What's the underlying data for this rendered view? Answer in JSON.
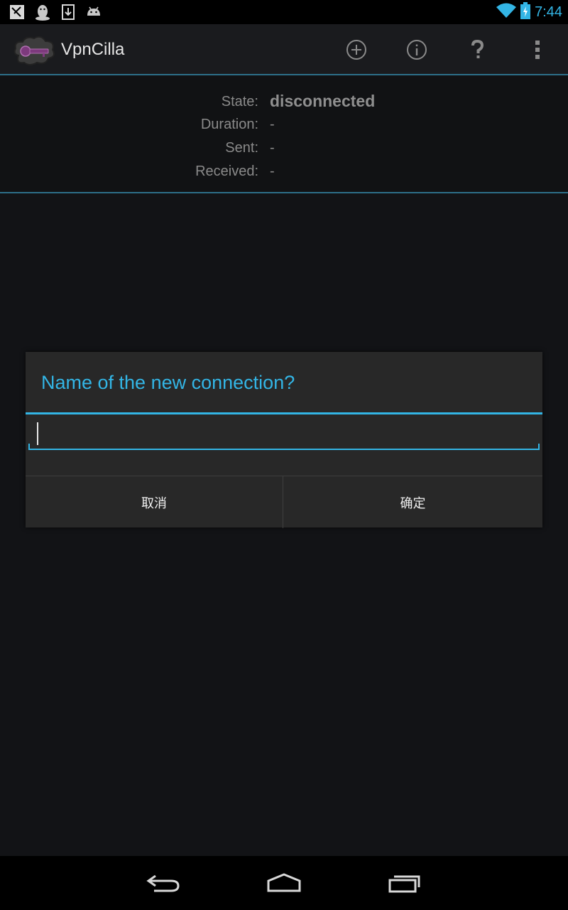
{
  "status_bar": {
    "time": "7:44",
    "left_icons": [
      "screenshot-icon",
      "qq-penguin-icon",
      "download-icon",
      "android-icon"
    ],
    "right_icons": [
      "wifi-icon",
      "battery-charging-icon"
    ]
  },
  "action_bar": {
    "title": "VpnCilla",
    "actions": [
      "add-icon",
      "info-icon",
      "help-icon",
      "overflow-menu-icon"
    ]
  },
  "status_panel": {
    "rows": [
      {
        "label": "State:",
        "value": "disconnected"
      },
      {
        "label": "Duration:",
        "value": "-"
      },
      {
        "label": "Sent:",
        "value": "-"
      },
      {
        "label": "Received:",
        "value": "-"
      }
    ]
  },
  "dialog": {
    "title": "Name of the new connection?",
    "input_value": "",
    "cancel_label": "取消",
    "ok_label": "确定"
  },
  "colors": {
    "accent": "#33b5e5",
    "divider": "#2d6f88",
    "background": "#111214",
    "dialog_bg": "#282828"
  }
}
